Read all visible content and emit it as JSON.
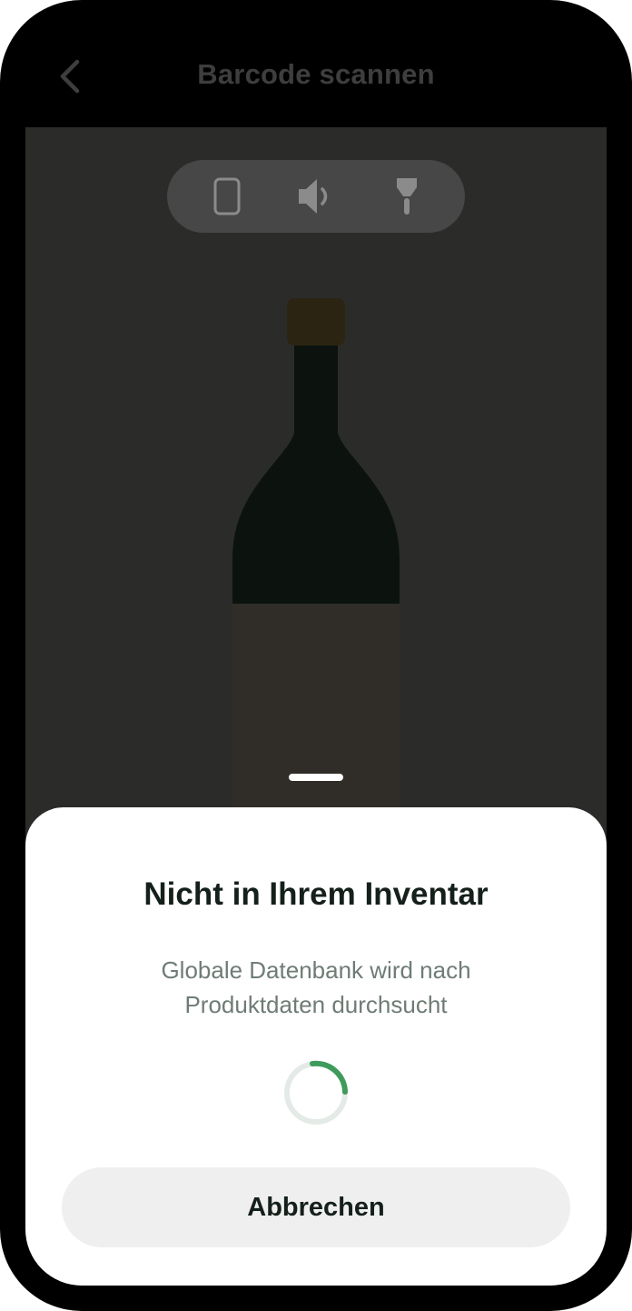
{
  "header": {
    "title": "Barcode scannen",
    "back_icon": "chevron-left-icon"
  },
  "camera_controls": {
    "items": [
      {
        "icon": "rotate-device-icon"
      },
      {
        "icon": "speaker-icon"
      },
      {
        "icon": "flashlight-icon"
      }
    ]
  },
  "sheet": {
    "title": "Nicht in Ihrem Inventar",
    "message_line1": "Globale Datenbank wird nach",
    "message_line2": "Produktdaten durchsucht",
    "cancel_label": "Abbrechen"
  },
  "colors": {
    "accent": "#3f9b5c",
    "spinner_track": "#e4ebe7",
    "camera_bg": "#2b2b2a",
    "controls_bg": "#474747"
  }
}
